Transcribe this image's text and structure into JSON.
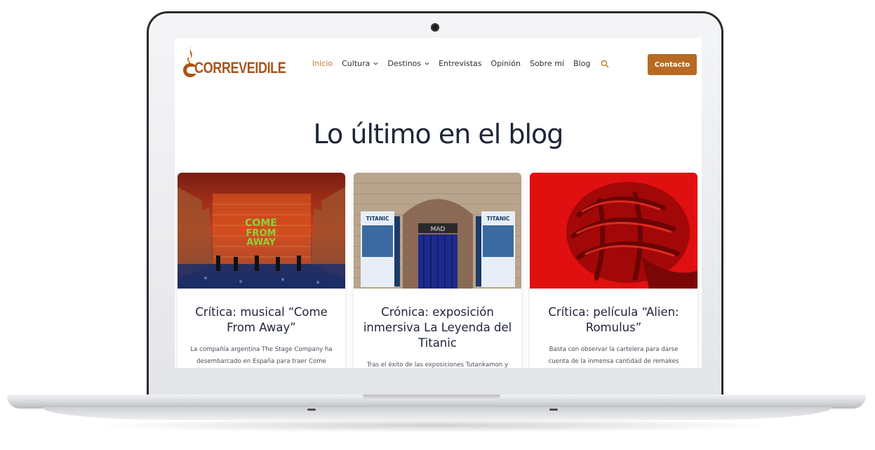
{
  "header": {
    "logo_text": "CORREVEIDILE",
    "nav": [
      {
        "label": "Inicio",
        "active": true,
        "dropdown": false
      },
      {
        "label": "Cultura",
        "active": false,
        "dropdown": true
      },
      {
        "label": "Destinos",
        "active": false,
        "dropdown": true
      },
      {
        "label": "Entrevistas",
        "active": false,
        "dropdown": false
      },
      {
        "label": "Opinión",
        "active": false,
        "dropdown": false
      },
      {
        "label": "Sobre mí",
        "active": false,
        "dropdown": false
      },
      {
        "label": "Blog",
        "active": false,
        "dropdown": false
      }
    ],
    "search_icon": "search-icon",
    "cta_label": "Contacto"
  },
  "section": {
    "title": "Lo último en el blog"
  },
  "posts": [
    {
      "title": "Crítica: musical “Come From Away”",
      "excerpt": "La compañía argentina The Stage Company ha desembarcado en España para traer Come",
      "image_text": [
        "COME",
        "FROM",
        "AWAY"
      ]
    },
    {
      "title": "Crónica: exposición inmersiva La Leyenda del Titanic",
      "excerpt": "Tras el éxito de las exposiciones Tutankamon y",
      "image_text": [
        "TITANIC",
        "MAD"
      ]
    },
    {
      "title": "Crítica: película “Alien: Romulus”",
      "excerpt": "Basta con observar la cartelera para darse cuenta de la inmensa cantidad de remakes",
      "image_text": []
    }
  ],
  "colors": {
    "accent": "#b86a22",
    "heading": "#1e2538",
    "text": "#4a4f5a"
  }
}
